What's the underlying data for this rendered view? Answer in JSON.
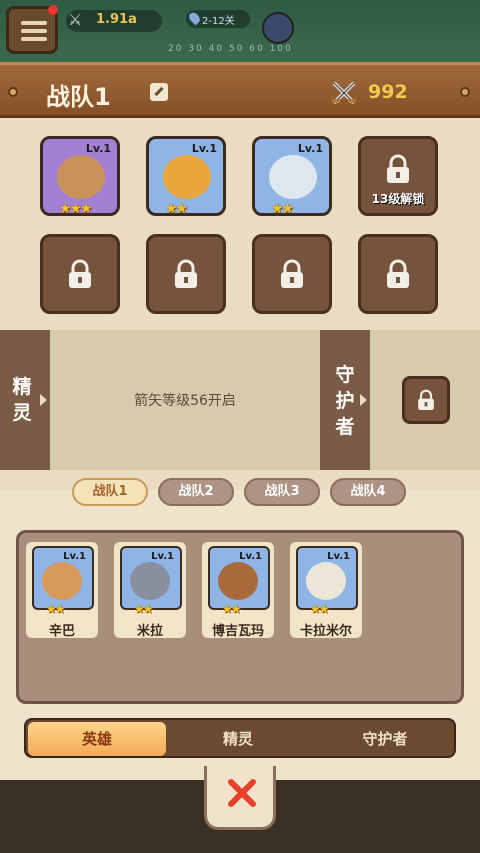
{
  "hud": {
    "power": "1.91a",
    "stage": "2-12关",
    "progress_ticks": "20 30 40 50 60 100"
  },
  "header": {
    "team_title": "战队1",
    "power_total": "992"
  },
  "lineup": {
    "heroes": [
      {
        "level": "Lv.1",
        "stars": "★★★"
      },
      {
        "level": "Lv.1",
        "stars": "★★"
      },
      {
        "level": "Lv.1",
        "stars": "★★"
      }
    ],
    "unlock_text": "13级解锁"
  },
  "strip": {
    "spirit_label": "精灵",
    "spirit_message": "箭矢等级56开启",
    "guardian_label": "守护者"
  },
  "team_tabs": [
    "战队1",
    "战队2",
    "战队3",
    "战队4"
  ],
  "roster": [
    {
      "name": "辛巴",
      "level": "Lv.1",
      "stars": "★★"
    },
    {
      "name": "米拉",
      "level": "Lv.1",
      "stars": "★★"
    },
    {
      "name": "博吉瓦玛",
      "level": "Lv.1",
      "stars": "★★"
    },
    {
      "name": "卡拉米尔",
      "level": "Lv.1",
      "stars": "★★"
    }
  ],
  "bottom_tabs": [
    "英雄",
    "精灵",
    "守护者"
  ],
  "colors": {
    "wood": "#874f27",
    "gold": "#f2c94a",
    "panel": "#e9dcc2",
    "active_tab": "#f3a958"
  }
}
